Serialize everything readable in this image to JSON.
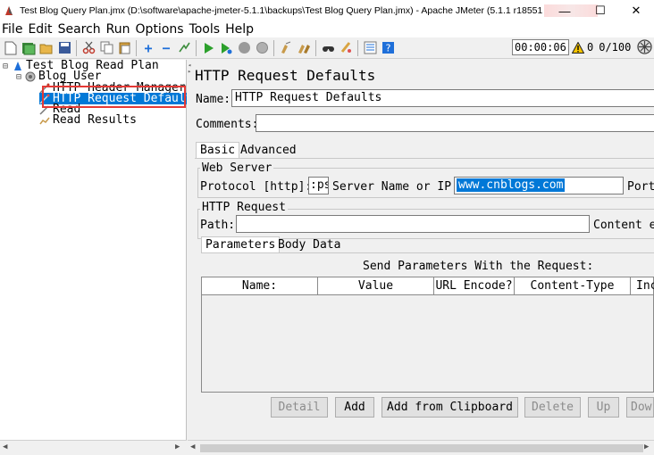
{
  "window": {
    "title": "Test Blog Query Plan.jmx (D:\\software\\apache-jmeter-5.1.1\\backups\\Test Blog Query Plan.jmx) - Apache JMeter (5.1.1 r18551",
    "minimize": "—",
    "maximize": "☐",
    "close": "✕"
  },
  "menu": [
    "File",
    "Edit",
    "Search",
    "Run",
    "Options",
    "Tools",
    "Help"
  ],
  "status": {
    "timer": "00:00:06",
    "warnings": "0",
    "threads": "0/100"
  },
  "tree": {
    "root": "Test Blog Read Plan",
    "thread_group": "Blog User",
    "items": [
      "HTTP Header Manager",
      "HTTP Request Default",
      "Read",
      "Read Results"
    ]
  },
  "panel": {
    "title": "HTTP Request Defaults",
    "name_label": "Name:",
    "name_value": "HTTP Request Defaults",
    "comments_label": "Comments:",
    "tabs": [
      "Basic",
      "Advanced"
    ],
    "web_server": {
      "legend": "Web Server",
      "protocol_label": "Protocol [http]:",
      "protocol_value": ":ps",
      "server_label": "Server Name or IP:",
      "server_value": "www.cnblogs.com",
      "port_label": "Port"
    },
    "http_request": {
      "legend": "HTTP Request",
      "path_label": "Path:",
      "content_label": "Content e"
    },
    "sub_tabs": [
      "Parameters",
      "Body Data"
    ],
    "send_params_label": "Send Parameters With the Request:",
    "columns": [
      "Name:",
      "Value",
      "URL Encode?",
      "Content-Type",
      "Inc"
    ],
    "buttons": {
      "detail": "Detail",
      "add": "Add",
      "add_clipboard": "Add from Clipboard",
      "delete": "Delete",
      "up": "Up",
      "down": "Dow"
    }
  },
  "colors": {
    "selection": "#0078d7",
    "highlight_box": "#e53935",
    "warning": "#f5c400"
  }
}
